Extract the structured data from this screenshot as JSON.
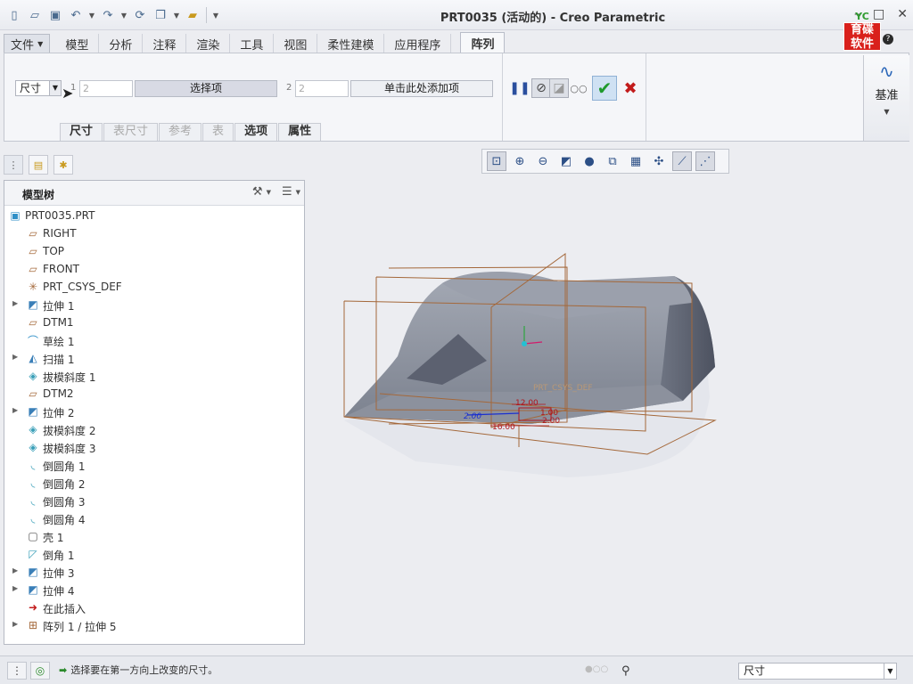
{
  "window": {
    "title": "PRT0035 (活动的) - Creo Parametric",
    "logo_top": "YC",
    "logo_line1": "育碟",
    "logo_line2": "软件",
    "help": "?"
  },
  "quick_access": {
    "icons": [
      "new-icon",
      "open-icon",
      "save-icon",
      "undo-icon",
      "redo-icon",
      "regenerate-icon",
      "windows-icon",
      "close-window-icon"
    ]
  },
  "ribbon_tabs": {
    "file": "文件",
    "items": [
      "模型",
      "分析",
      "注释",
      "渲染",
      "工具",
      "视图",
      "柔性建模",
      "应用程序"
    ],
    "active": "阵列"
  },
  "pattern": {
    "type_value": "尺寸",
    "dir1_label": "1",
    "dir1_count": "2",
    "dir1_collector": "选择项",
    "dir2_label": "2",
    "dir2_count": "2",
    "dir2_collector": "单击此处添加项",
    "datum_label": "基准",
    "subtabs": [
      {
        "label": "尺寸",
        "enabled": true
      },
      {
        "label": "表尺寸",
        "enabled": false
      },
      {
        "label": "参考",
        "enabled": false
      },
      {
        "label": "表",
        "enabled": false
      },
      {
        "label": "选项",
        "enabled": true
      },
      {
        "label": "属性",
        "enabled": true
      }
    ]
  },
  "model_tree": {
    "title": "模型树",
    "items": [
      {
        "label": "PRT0035.PRT",
        "icon": "part-icon",
        "expandable": false
      },
      {
        "label": "RIGHT",
        "icon": "datum-plane-icon",
        "expandable": false
      },
      {
        "label": "TOP",
        "icon": "datum-plane-icon",
        "expandable": false
      },
      {
        "label": "FRONT",
        "icon": "datum-plane-icon",
        "expandable": false
      },
      {
        "label": "PRT_CSYS_DEF",
        "icon": "csys-icon",
        "expandable": false
      },
      {
        "label": "拉伸 1",
        "icon": "extrude-icon",
        "expandable": true
      },
      {
        "label": "DTM1",
        "icon": "datum-plane-icon",
        "expandable": false
      },
      {
        "label": "草绘 1",
        "icon": "sketch-icon",
        "expandable": false
      },
      {
        "label": "扫描 1",
        "icon": "sweep-icon",
        "expandable": true
      },
      {
        "label": "拔模斜度 1",
        "icon": "draft-icon",
        "expandable": false
      },
      {
        "label": "DTM2",
        "icon": "datum-plane-icon",
        "expandable": false
      },
      {
        "label": "拉伸 2",
        "icon": "extrude-icon",
        "expandable": true
      },
      {
        "label": "拔模斜度 2",
        "icon": "draft-icon",
        "expandable": false
      },
      {
        "label": "拔模斜度 3",
        "icon": "draft-icon",
        "expandable": false
      },
      {
        "label": "倒圆角 1",
        "icon": "round-icon",
        "expandable": false
      },
      {
        "label": "倒圆角 2",
        "icon": "round-icon",
        "expandable": false
      },
      {
        "label": "倒圆角 3",
        "icon": "round-icon",
        "expandable": false
      },
      {
        "label": "倒圆角 4",
        "icon": "round-icon",
        "expandable": false
      },
      {
        "label": "壳 1",
        "icon": "shell-icon",
        "expandable": false
      },
      {
        "label": "倒角 1",
        "icon": "chamfer-icon",
        "expandable": false
      },
      {
        "label": "拉伸 3",
        "icon": "extrude-icon",
        "expandable": true
      },
      {
        "label": "拉伸 4",
        "icon": "extrude-icon",
        "expandable": true
      },
      {
        "label": "在此插入",
        "icon": "insert-here-icon",
        "expandable": false
      },
      {
        "label": "阵列 1 / 拉伸 5",
        "icon": "pattern-icon",
        "expandable": true
      }
    ]
  },
  "viewport": {
    "csys_label": "PRT_CSYS_DEF",
    "dims": [
      "12.00",
      "16.00",
      "1.00",
      "2.00"
    ]
  },
  "status": {
    "message": "选择要在第一方向上改变的尺寸。",
    "filter_value": "尺寸"
  },
  "colors": {
    "accent": "#2a66b8",
    "ok": "#1f9a2c",
    "cancel": "#c21b1b",
    "datum_line": "#a4683a",
    "dim_text": "#b0151b",
    "dim_blue": "#1a2fd0"
  }
}
